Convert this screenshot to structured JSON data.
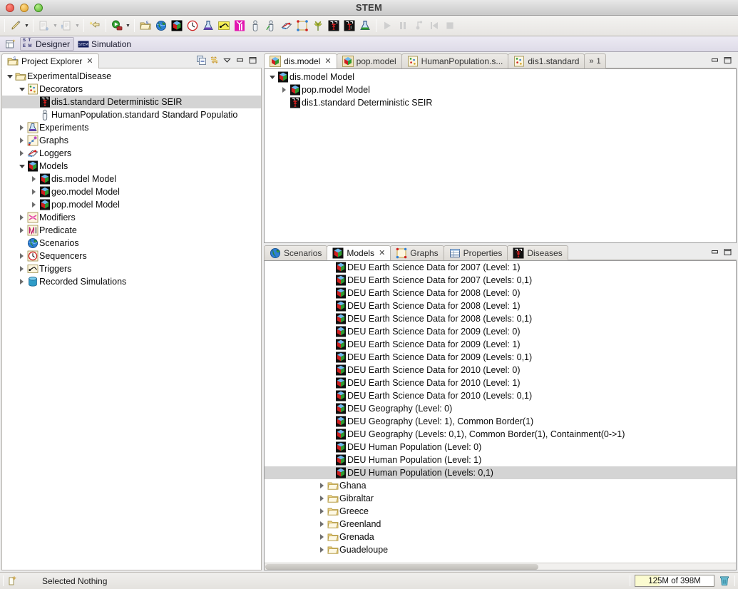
{
  "window": {
    "title": "STEM"
  },
  "titlebar": {
    "close_label": "close",
    "minimize_label": "minimize",
    "zoom_label": "zoom"
  },
  "toolbar": {
    "groups": [
      {
        "items": [
          {
            "icon": "pencil-new-icon",
            "arrow": true,
            "enabled": true
          }
        ]
      },
      {
        "items": [
          {
            "icon": "import-icon",
            "arrow": true,
            "enabled": false
          },
          {
            "icon": "export-icon",
            "arrow": true,
            "enabled": false
          }
        ]
      },
      {
        "items": [
          {
            "icon": "new-wizard-arrow-icon",
            "arrow": false,
            "enabled": true
          }
        ]
      },
      {
        "items": [
          {
            "icon": "run-icon",
            "arrow": true,
            "enabled": true
          }
        ]
      },
      {
        "items": [
          {
            "icon": "open-project-icon"
          },
          {
            "icon": "globe-scenario-icon"
          },
          {
            "icon": "model-cubes-icon"
          },
          {
            "icon": "clock-sequencer-icon"
          },
          {
            "icon": "flask-experiment-icon"
          },
          {
            "icon": "trigger-switch-icon"
          },
          {
            "icon": "vaccine-icon"
          },
          {
            "icon": "person-population-icon"
          },
          {
            "icon": "person-green-population-icon"
          },
          {
            "icon": "logger-icon"
          },
          {
            "icon": "graph-nodes-icon"
          },
          {
            "icon": "plant-crop-icon"
          },
          {
            "icon": "disease-seir-icon"
          },
          {
            "icon": "disease-seir-i-icon"
          },
          {
            "icon": "flask-green-icon"
          }
        ]
      },
      {
        "items": [
          {
            "icon": "play-icon",
            "enabled": false
          },
          {
            "icon": "pause-icon",
            "enabled": false
          },
          {
            "icon": "step-icon",
            "enabled": false
          },
          {
            "icon": "rewind-icon",
            "enabled": false
          },
          {
            "icon": "stop-icon",
            "enabled": false
          }
        ]
      }
    ]
  },
  "perspective_bar": {
    "open_perspective_label": "",
    "items": [
      {
        "label": "Designer",
        "icon": "stem-letters-icon",
        "active": true
      },
      {
        "label": "Simulation",
        "icon": "stem-badge-icon",
        "active": false
      }
    ]
  },
  "project_explorer": {
    "tab_label": "Project Explorer",
    "tab_icon": "project-explorer-icon",
    "close_label": "✕",
    "buttons": [
      {
        "name": "collapse-all-button",
        "icon": "collapse-all-icon"
      },
      {
        "name": "link-with-editor-button",
        "icon": "link-editor-icon"
      },
      {
        "name": "view-menu-button",
        "icon": "chevron-down-icon"
      },
      {
        "name": "minimize-button",
        "icon": "minimize-icon"
      },
      {
        "name": "maximize-button",
        "icon": "maximize-icon"
      }
    ],
    "tree": [
      {
        "label": "ExperimentalDisease",
        "icon": "folder-project-icon",
        "depth": 0,
        "twisty": "open",
        "selected": false
      },
      {
        "label": "Decorators",
        "icon": "decorators-icon",
        "depth": 1,
        "twisty": "open",
        "selected": false
      },
      {
        "label": "dis1.standard Deterministic SEIR",
        "icon": "disease-seir-icon",
        "depth": 2,
        "twisty": "none",
        "selected": true
      },
      {
        "label": "HumanPopulation.standard Standard Populatio",
        "icon": "person-population-icon",
        "depth": 2,
        "twisty": "none",
        "selected": false
      },
      {
        "label": "Experiments",
        "icon": "flask-experiment-icon",
        "depth": 1,
        "twisty": "closed",
        "selected": false
      },
      {
        "label": "Graphs",
        "icon": "graphs-icon",
        "depth": 1,
        "twisty": "closed",
        "selected": false
      },
      {
        "label": "Loggers",
        "icon": "logger-icon",
        "depth": 1,
        "twisty": "closed",
        "selected": false
      },
      {
        "label": "Models",
        "icon": "model-cubes-icon",
        "depth": 1,
        "twisty": "open",
        "selected": false
      },
      {
        "label": "dis.model Model",
        "icon": "model-cubes-icon",
        "depth": 2,
        "twisty": "closed",
        "selected": false
      },
      {
        "label": "geo.model Model",
        "icon": "model-cubes-icon",
        "depth": 2,
        "twisty": "closed",
        "selected": false
      },
      {
        "label": "pop.model Model",
        "icon": "model-cubes-icon",
        "depth": 2,
        "twisty": "closed",
        "selected": false
      },
      {
        "label": "Modifiers",
        "icon": "modifiers-icon",
        "depth": 1,
        "twisty": "closed",
        "selected": false
      },
      {
        "label": "Predicate",
        "icon": "predicate-icon",
        "depth": 1,
        "twisty": "closed",
        "selected": false
      },
      {
        "label": "Scenarios",
        "icon": "globe-scenario-icon",
        "depth": 1,
        "twisty": "none",
        "selected": false
      },
      {
        "label": "Sequencers",
        "icon": "clock-sequencer-icon",
        "depth": 1,
        "twisty": "closed",
        "selected": false
      },
      {
        "label": "Triggers",
        "icon": "trigger-switch-icon",
        "depth": 1,
        "twisty": "closed",
        "selected": false
      },
      {
        "label": "Recorded Simulations",
        "icon": "database-icon",
        "depth": 1,
        "twisty": "closed",
        "selected": false
      }
    ]
  },
  "editor_area": {
    "tabs": [
      {
        "label": "dis.model",
        "icon": "model-cubes-icon",
        "active": true,
        "closable": true
      },
      {
        "label": "pop.model",
        "icon": "model-cubes-icon",
        "active": false,
        "closable": false
      },
      {
        "label": "HumanPopulation.s...",
        "icon": "decorators-icon",
        "active": false,
        "closable": false
      },
      {
        "label": "dis1.standard",
        "icon": "decorators-icon",
        "active": false,
        "closable": false
      }
    ],
    "overflow_label": "1",
    "overflow_icon": "chevrons-right-icon",
    "buttons": [
      {
        "name": "minimize-button",
        "icon": "minimize-icon"
      },
      {
        "name": "maximize-button",
        "icon": "maximize-icon"
      }
    ],
    "tree": [
      {
        "label": "dis.model Model",
        "icon": "model-cubes-icon",
        "depth": 0,
        "twisty": "open"
      },
      {
        "label": "pop.model Model",
        "icon": "model-cubes-icon",
        "depth": 1,
        "twisty": "closed"
      },
      {
        "label": "dis1.standard Deterministic SEIR",
        "icon": "disease-seir-icon",
        "depth": 1,
        "twisty": "none"
      }
    ]
  },
  "bottom_area": {
    "tabs": [
      {
        "label": "Scenarios",
        "icon": "globe-scenario-icon",
        "active": false,
        "closable": false
      },
      {
        "label": "Models",
        "icon": "model-cubes-icon",
        "active": true,
        "closable": true
      },
      {
        "label": "Graphs",
        "icon": "graphs-icon",
        "active": false,
        "closable": false
      },
      {
        "label": "Properties",
        "icon": "properties-icon",
        "active": false,
        "closable": false
      },
      {
        "label": "Diseases",
        "icon": "disease-seir-icon",
        "active": false,
        "closable": false
      }
    ],
    "buttons": [
      {
        "name": "minimize-button",
        "icon": "minimize-icon"
      },
      {
        "name": "maximize-button",
        "icon": "maximize-icon"
      }
    ],
    "items": [
      {
        "label": "DEU Earth Science Data for 2007 (Level: 1)",
        "icon": "model-cubes-icon",
        "kind": "model",
        "selected": false
      },
      {
        "label": "DEU Earth Science Data for 2007 (Levels: 0,1)",
        "icon": "model-cubes-icon",
        "kind": "model",
        "selected": false
      },
      {
        "label": "DEU Earth Science Data for 2008 (Level: 0)",
        "icon": "model-cubes-icon",
        "kind": "model",
        "selected": false
      },
      {
        "label": "DEU Earth Science Data for 2008 (Level: 1)",
        "icon": "model-cubes-icon",
        "kind": "model",
        "selected": false
      },
      {
        "label": "DEU Earth Science Data for 2008 (Levels: 0,1)",
        "icon": "model-cubes-icon",
        "kind": "model",
        "selected": false
      },
      {
        "label": "DEU Earth Science Data for 2009 (Level: 0)",
        "icon": "model-cubes-icon",
        "kind": "model",
        "selected": false
      },
      {
        "label": "DEU Earth Science Data for 2009 (Level: 1)",
        "icon": "model-cubes-icon",
        "kind": "model",
        "selected": false
      },
      {
        "label": "DEU Earth Science Data for 2009 (Levels: 0,1)",
        "icon": "model-cubes-icon",
        "kind": "model",
        "selected": false
      },
      {
        "label": "DEU Earth Science Data for 2010 (Level: 0)",
        "icon": "model-cubes-icon",
        "kind": "model",
        "selected": false
      },
      {
        "label": "DEU Earth Science Data for 2010 (Level: 1)",
        "icon": "model-cubes-icon",
        "kind": "model",
        "selected": false
      },
      {
        "label": "DEU Earth Science Data for 2010 (Levels: 0,1)",
        "icon": "model-cubes-icon",
        "kind": "model",
        "selected": false
      },
      {
        "label": "DEU Geography (Level: 0)",
        "icon": "model-cubes-icon",
        "kind": "model",
        "selected": false
      },
      {
        "label": "DEU Geography (Level: 1), Common Border(1)",
        "icon": "model-cubes-icon",
        "kind": "model",
        "selected": false
      },
      {
        "label": "DEU Geography (Levels: 0,1), Common Border(1), Containment(0->1)",
        "icon": "model-cubes-icon",
        "kind": "model",
        "selected": false
      },
      {
        "label": "DEU Human Population (Level: 0)",
        "icon": "model-cubes-icon",
        "kind": "model",
        "selected": false
      },
      {
        "label": "DEU Human Population (Level: 1)",
        "icon": "model-cubes-icon",
        "kind": "model",
        "selected": false
      },
      {
        "label": "DEU Human Population (Levels: 0,1)",
        "icon": "model-cubes-icon",
        "kind": "model",
        "selected": true
      },
      {
        "label": "Ghana",
        "icon": "folder-icon",
        "kind": "folder",
        "selected": false
      },
      {
        "label": "Gibraltar",
        "icon": "folder-icon",
        "kind": "folder",
        "selected": false
      },
      {
        "label": "Greece",
        "icon": "folder-icon",
        "kind": "folder",
        "selected": false
      },
      {
        "label": "Greenland",
        "icon": "folder-icon",
        "kind": "folder",
        "selected": false
      },
      {
        "label": "Grenada",
        "icon": "folder-icon",
        "kind": "folder",
        "selected": false
      },
      {
        "label": "Guadeloupe",
        "icon": "folder-icon",
        "kind": "folder",
        "selected": false
      }
    ]
  },
  "status_bar": {
    "left_icon": "selection-icon",
    "selection_text": "Selected Nothing",
    "heap": {
      "label": "125M of 398M",
      "used_mb": 125,
      "total_mb": 398,
      "percent": 31
    },
    "gc_icon": "trash-icon"
  },
  "colors": {
    "selection": "#d4d4d4",
    "heap_fill": "#fbfbd0",
    "accent_folder": "#e8b84b",
    "view_background": "#ffffff",
    "chrome": "#ececec"
  }
}
